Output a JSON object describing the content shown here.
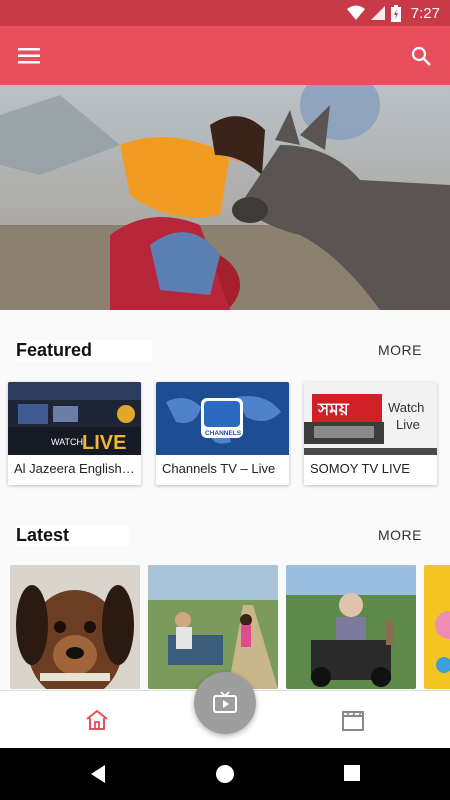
{
  "status_bar": {
    "time": "7:27"
  },
  "app_bar": {
    "menu_icon": "hamburger-menu-icon",
    "search_icon": "search-icon"
  },
  "featured": {
    "title": "Featured",
    "more_label": "MORE",
    "items": [
      {
        "title": "Al Jazeera English…",
        "thumb_watch": "WATCH",
        "thumb_live": "LIVE"
      },
      {
        "title": "Channels TV – Live",
        "thumb_logo": "CHANNELS"
      },
      {
        "title": "SOMOY TV LIVE",
        "thumb_brand": "সময়",
        "thumb_watch": "Watch",
        "thumb_live": "Live"
      }
    ]
  },
  "latest": {
    "title": "Latest",
    "more_label": "MORE"
  },
  "bottom_nav": {
    "home_icon": "home-icon",
    "tv_icon": "tv-icon",
    "movies_icon": "clapperboard-icon"
  },
  "colors": {
    "accent": "#e84e5b",
    "statusbar": "#c93a48",
    "fab": "#9e9e9e"
  }
}
